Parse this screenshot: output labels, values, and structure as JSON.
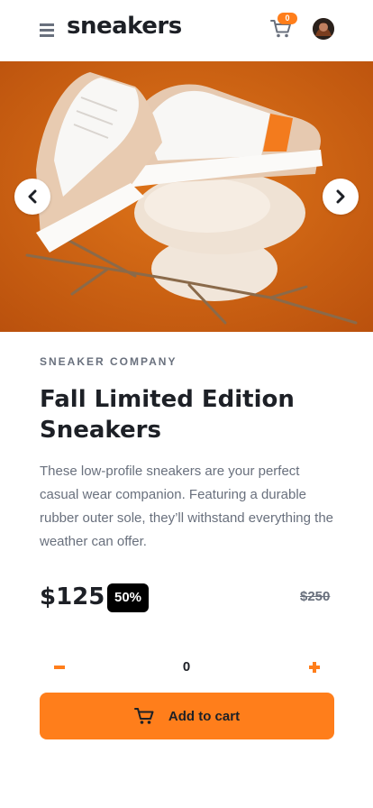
{
  "header": {
    "logo": "sneakers",
    "cart_count": "0",
    "icons": [
      "menu-icon",
      "cart-icon",
      "avatar"
    ]
  },
  "gallery": {
    "icons": [
      "chevron-left-icon",
      "chevron-right-icon"
    ]
  },
  "product": {
    "company": "SNEAKER COMPANY",
    "title": "Fall Limited Edition Sneakers",
    "description": "These low-profile sneakers are your perfect casual wear companion. Featuring a durable rubber outer sole, they’ll withstand everything the weather can offer.",
    "price": "$125",
    "discount": "50%",
    "original_price": "$250"
  },
  "quantity": {
    "value": "0",
    "icons": [
      "minus-icon",
      "plus-icon"
    ]
  },
  "cart_button": {
    "label": "Add to cart",
    "icon": "cart-icon"
  },
  "colors": {
    "accent": "#ff7e1b",
    "dark": "#1d2026",
    "muted": "#69707d",
    "background": "#ffffff"
  }
}
